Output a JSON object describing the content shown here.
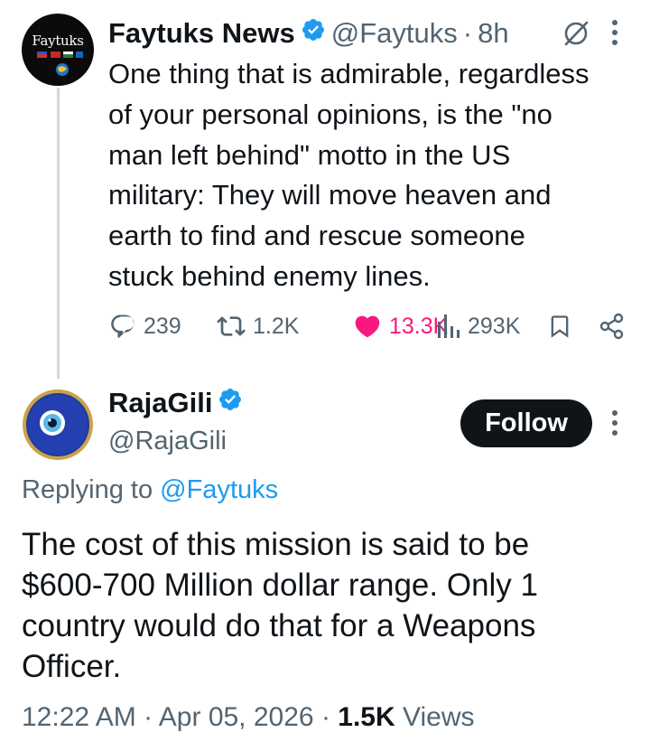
{
  "parent_tweet": {
    "avatar_text": "Faytuks",
    "display_name": "Faytuks News",
    "handle": "@Faytuks",
    "separator": "·",
    "time_ago": "8h",
    "text": "One thing that is admirable, regardless\nof your personal opinions, is the \"no\nman left behind\" motto in the US\nmilitary: They will move heaven and\nearth to find and rescue someone\nstuck behind enemy lines.",
    "stats": {
      "replies": "239",
      "retweets": "1.2K",
      "likes": "13.3K",
      "views": "293K"
    }
  },
  "reply": {
    "display_name": "RajaGili",
    "handle": "@RajaGili",
    "follow_label": "Follow",
    "replying_prefix": "Replying to",
    "replying_mention": "@Faytuks",
    "text": "The cost of this mission is said to be\n$600-700 Million dollar range. Only 1\ncountry would do that for a Weapons\nOfficer.",
    "time": "12:22 AM",
    "separator": "·",
    "date": "Apr 05, 2026",
    "views_count": "1.5K",
    "views_label": "Views"
  },
  "icons": {
    "verified": "verified-badge-icon",
    "grok": "grok-icon",
    "more": "more-options-icon",
    "reply": "reply-icon",
    "retweet": "retweet-icon",
    "like": "heart-filled-icon",
    "views": "views-chart-icon",
    "bookmark": "bookmark-icon",
    "share": "share-icon"
  },
  "colors": {
    "verified_blue": "#1d9bf0",
    "like_pink": "#f91880",
    "muted_gray": "#536471",
    "text_dark": "#0f1419",
    "follow_bg": "#0f1419"
  }
}
